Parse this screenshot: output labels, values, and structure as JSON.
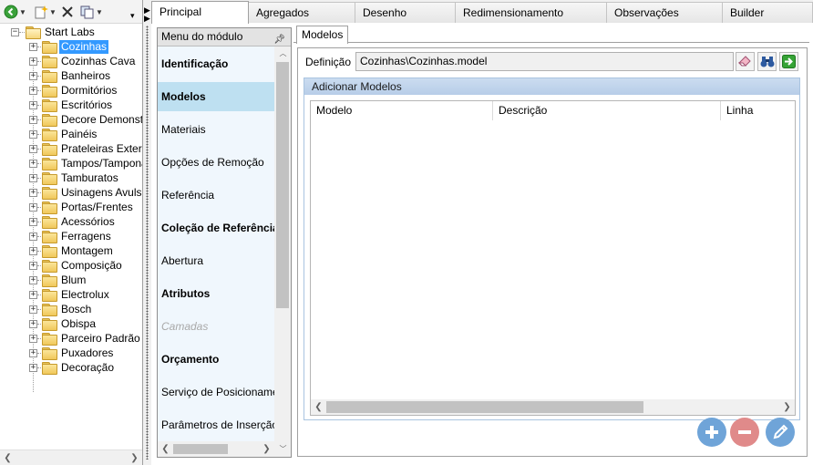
{
  "tree": {
    "root": "Start Labs",
    "items": [
      {
        "label": "Cozinhas",
        "selected": true
      },
      {
        "label": "Cozinhas Cava"
      },
      {
        "label": "Banheiros"
      },
      {
        "label": "Dormitórios"
      },
      {
        "label": "Escritórios"
      },
      {
        "label": "Decore Demonstr"
      },
      {
        "label": "Painéis"
      },
      {
        "label": "Prateleiras Exterr"
      },
      {
        "label": "Tampos/Tampona"
      },
      {
        "label": "Tamburatos"
      },
      {
        "label": "Usinagens Avulsa"
      },
      {
        "label": "Portas/Frentes"
      },
      {
        "label": "Acessórios"
      },
      {
        "label": "Ferragens"
      },
      {
        "label": "Montagem"
      },
      {
        "label": "Composição"
      },
      {
        "label": "Blum"
      },
      {
        "label": "Electrolux"
      },
      {
        "label": "Bosch"
      },
      {
        "label": "Obispa"
      },
      {
        "label": "Parceiro Padrão"
      },
      {
        "label": "Puxadores"
      },
      {
        "label": "Decoração"
      }
    ]
  },
  "main_tabs": [
    "Principal",
    "Agregados",
    "Desenho",
    "Redimensionamento",
    "Observações",
    "Builder"
  ],
  "module_menu": {
    "title": "Menu do módulo",
    "items": [
      {
        "label": "Identificação",
        "bold": true
      },
      {
        "label": "Modelos",
        "bold": true,
        "selected": true
      },
      {
        "label": "Materiais"
      },
      {
        "label": "Opções de Remoção"
      },
      {
        "label": "Referência"
      },
      {
        "label": "Coleção de Referências",
        "bold": true
      },
      {
        "label": "Abertura"
      },
      {
        "label": "Atributos",
        "bold": true
      },
      {
        "label": "Camadas",
        "disabled": true
      },
      {
        "label": "Orçamento",
        "bold": true
      },
      {
        "label": "Serviço de Posicionamen"
      },
      {
        "label": "Parâmetros de Inserção"
      }
    ]
  },
  "sub_tab": "Modelos",
  "definition": {
    "label": "Definição",
    "value": "Cozinhas\\Cozinhas.model"
  },
  "models_group": {
    "title": "Adicionar Modelos",
    "columns": [
      "Modelo",
      "Descrição",
      "Linha"
    ]
  },
  "icons": {
    "toolbar": [
      "back-icon",
      "new-item-icon",
      "delete-icon",
      "copy-icon",
      "overflow-icon"
    ],
    "definition": [
      "eraser-icon",
      "binoculars-icon",
      "go-arrow-icon"
    ],
    "actions": [
      "plus-icon",
      "minus-icon",
      "pencil-icon"
    ]
  },
  "colors": {
    "selection": "#3399ff",
    "menu_selected": "#bee0f1",
    "group_header": "#b7cde8",
    "add_button": "#6fa4d8",
    "remove_button": "#e08a8a"
  }
}
